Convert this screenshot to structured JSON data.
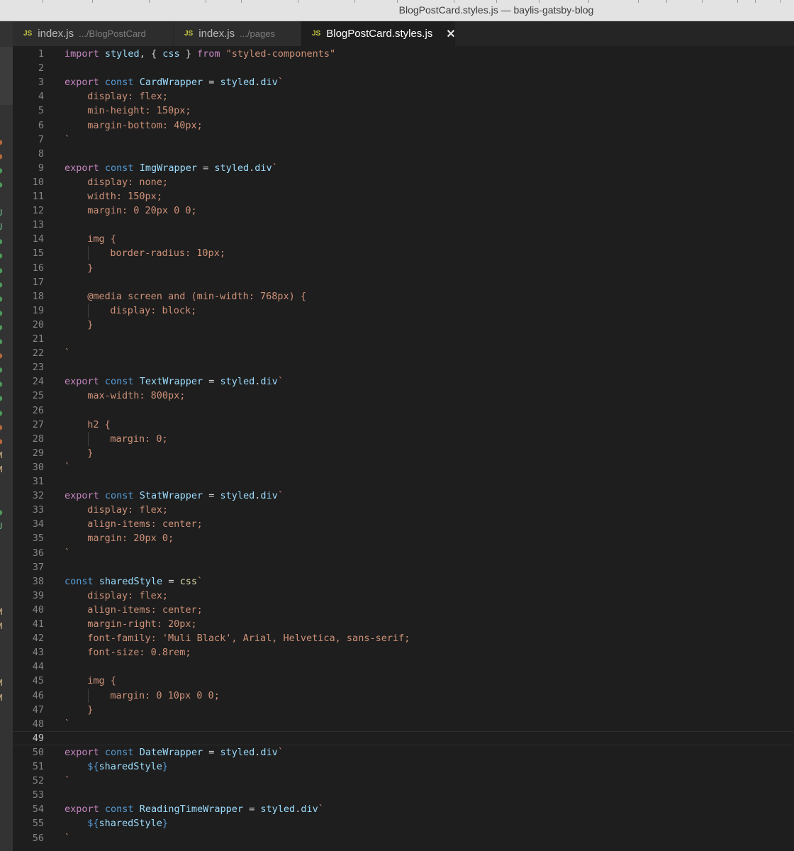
{
  "window": {
    "title": "BlogPostCard.styles.js — baylis-gatsby-blog"
  },
  "tabs": [
    {
      "icon": "JS",
      "name": "index.js",
      "description": ".../BlogPostCard",
      "active": false
    },
    {
      "icon": "JS",
      "name": "index.js",
      "description": ".../pages",
      "active": false
    },
    {
      "icon": "JS",
      "name": "BlogPostCard.styles.js",
      "description": "",
      "active": true,
      "close": "✕"
    }
  ],
  "editor": {
    "current_line": 49,
    "colors": {
      "keyword": "#c586c0",
      "storage": "#569cd6",
      "identifier": "#9cdcfe",
      "function": "#dcdcaa",
      "string": "#ce9178",
      "plain": "#d4d4d4"
    },
    "lines": [
      {
        "n": "1",
        "indent": 0,
        "tokens": [
          [
            "kw",
            "import"
          ],
          [
            "pl",
            " "
          ],
          [
            "id",
            "styled"
          ],
          [
            "pl",
            ", { "
          ],
          [
            "id",
            "css"
          ],
          [
            "pl",
            " } "
          ],
          [
            "kw",
            "from"
          ],
          [
            "pl",
            " "
          ],
          [
            "str",
            "\"styled-components\""
          ]
        ]
      },
      {
        "n": "2",
        "indent": 0,
        "tokens": []
      },
      {
        "n": "3",
        "indent": 0,
        "tokens": [
          [
            "kw",
            "export"
          ],
          [
            "pl",
            " "
          ],
          [
            "st",
            "const"
          ],
          [
            "pl",
            " "
          ],
          [
            "id",
            "CardWrapper"
          ],
          [
            "pl",
            " = "
          ],
          [
            "id",
            "styled"
          ],
          [
            "pl",
            "."
          ],
          [
            "id",
            "div"
          ],
          [
            "str",
            "`"
          ]
        ]
      },
      {
        "n": "4",
        "indent": 1,
        "tokens": [
          [
            "str",
            "display: flex;"
          ]
        ]
      },
      {
        "n": "5",
        "indent": 1,
        "tokens": [
          [
            "str",
            "min-height: 150px;"
          ]
        ]
      },
      {
        "n": "6",
        "indent": 1,
        "tokens": [
          [
            "str",
            "margin-bottom: 40px;"
          ]
        ]
      },
      {
        "n": "7",
        "indent": 0,
        "tokens": [
          [
            "str",
            "`"
          ]
        ]
      },
      {
        "n": "8",
        "indent": 0,
        "tokens": []
      },
      {
        "n": "9",
        "indent": 0,
        "tokens": [
          [
            "kw",
            "export"
          ],
          [
            "pl",
            " "
          ],
          [
            "st",
            "const"
          ],
          [
            "pl",
            " "
          ],
          [
            "id",
            "ImgWrapper"
          ],
          [
            "pl",
            " = "
          ],
          [
            "id",
            "styled"
          ],
          [
            "pl",
            "."
          ],
          [
            "id",
            "div"
          ],
          [
            "str",
            "`"
          ]
        ]
      },
      {
        "n": "10",
        "indent": 1,
        "tokens": [
          [
            "str",
            "display: none;"
          ]
        ]
      },
      {
        "n": "11",
        "indent": 1,
        "tokens": [
          [
            "str",
            "width: 150px;"
          ]
        ]
      },
      {
        "n": "12",
        "indent": 1,
        "tokens": [
          [
            "str",
            "margin: 0 20px 0 0;"
          ]
        ]
      },
      {
        "n": "13",
        "indent": 0,
        "tokens": []
      },
      {
        "n": "14",
        "indent": 1,
        "tokens": [
          [
            "str",
            "img {"
          ]
        ]
      },
      {
        "n": "15",
        "indent": 2,
        "tokens": [
          [
            "str",
            "border-radius: 10px;"
          ]
        ]
      },
      {
        "n": "16",
        "indent": 1,
        "tokens": [
          [
            "str",
            "}"
          ]
        ]
      },
      {
        "n": "17",
        "indent": 0,
        "tokens": []
      },
      {
        "n": "18",
        "indent": 1,
        "tokens": [
          [
            "str",
            "@media screen and (min-width: 768px) {"
          ]
        ]
      },
      {
        "n": "19",
        "indent": 2,
        "tokens": [
          [
            "str",
            "display: block;"
          ]
        ]
      },
      {
        "n": "20",
        "indent": 1,
        "tokens": [
          [
            "str",
            "}"
          ]
        ]
      },
      {
        "n": "21",
        "indent": 0,
        "tokens": []
      },
      {
        "n": "22",
        "indent": 0,
        "tokens": [
          [
            "str",
            "`"
          ]
        ]
      },
      {
        "n": "23",
        "indent": 0,
        "tokens": []
      },
      {
        "n": "24",
        "indent": 0,
        "tokens": [
          [
            "kw",
            "export"
          ],
          [
            "pl",
            " "
          ],
          [
            "st",
            "const"
          ],
          [
            "pl",
            " "
          ],
          [
            "id",
            "TextWrapper"
          ],
          [
            "pl",
            " = "
          ],
          [
            "id",
            "styled"
          ],
          [
            "pl",
            "."
          ],
          [
            "id",
            "div"
          ],
          [
            "str",
            "`"
          ]
        ]
      },
      {
        "n": "25",
        "indent": 1,
        "tokens": [
          [
            "str",
            "max-width: 800px;"
          ]
        ]
      },
      {
        "n": "26",
        "indent": 0,
        "tokens": []
      },
      {
        "n": "27",
        "indent": 1,
        "tokens": [
          [
            "str",
            "h2 {"
          ]
        ]
      },
      {
        "n": "28",
        "indent": 2,
        "tokens": [
          [
            "str",
            "margin: 0;"
          ]
        ]
      },
      {
        "n": "29",
        "indent": 1,
        "tokens": [
          [
            "str",
            "}"
          ]
        ]
      },
      {
        "n": "30",
        "indent": 0,
        "tokens": [
          [
            "str",
            "`"
          ]
        ]
      },
      {
        "n": "31",
        "indent": 0,
        "tokens": []
      },
      {
        "n": "32",
        "indent": 0,
        "tokens": [
          [
            "kw",
            "export"
          ],
          [
            "pl",
            " "
          ],
          [
            "st",
            "const"
          ],
          [
            "pl",
            " "
          ],
          [
            "id",
            "StatWrapper"
          ],
          [
            "pl",
            " = "
          ],
          [
            "id",
            "styled"
          ],
          [
            "pl",
            "."
          ],
          [
            "id",
            "div"
          ],
          [
            "str",
            "`"
          ]
        ]
      },
      {
        "n": "33",
        "indent": 1,
        "tokens": [
          [
            "str",
            "display: flex;"
          ]
        ]
      },
      {
        "n": "34",
        "indent": 1,
        "tokens": [
          [
            "str",
            "align-items: center;"
          ]
        ]
      },
      {
        "n": "35",
        "indent": 1,
        "tokens": [
          [
            "str",
            "margin: 20px 0;"
          ]
        ]
      },
      {
        "n": "36",
        "indent": 0,
        "tokens": [
          [
            "str",
            "`"
          ]
        ]
      },
      {
        "n": "37",
        "indent": 0,
        "tokens": []
      },
      {
        "n": "38",
        "indent": 0,
        "tokens": [
          [
            "st",
            "const"
          ],
          [
            "pl",
            " "
          ],
          [
            "id",
            "sharedStyle"
          ],
          [
            "pl",
            " = "
          ],
          [
            "fn",
            "css"
          ],
          [
            "str",
            "`"
          ]
        ]
      },
      {
        "n": "39",
        "indent": 1,
        "tokens": [
          [
            "str",
            "display: flex;"
          ]
        ]
      },
      {
        "n": "40",
        "indent": 1,
        "tokens": [
          [
            "str",
            "align-items: center;"
          ]
        ]
      },
      {
        "n": "41",
        "indent": 1,
        "tokens": [
          [
            "str",
            "margin-right: 20px;"
          ]
        ]
      },
      {
        "n": "42",
        "indent": 1,
        "tokens": [
          [
            "str",
            "font-family: 'Muli Black', Arial, Helvetica, sans-serif;"
          ]
        ]
      },
      {
        "n": "43",
        "indent": 1,
        "tokens": [
          [
            "str",
            "font-size: 0.8rem;"
          ]
        ]
      },
      {
        "n": "44",
        "indent": 0,
        "tokens": []
      },
      {
        "n": "45",
        "indent": 1,
        "tokens": [
          [
            "str",
            "img {"
          ]
        ]
      },
      {
        "n": "46",
        "indent": 2,
        "tokens": [
          [
            "str",
            "margin: 0 10px 0 0;"
          ]
        ]
      },
      {
        "n": "47",
        "indent": 1,
        "tokens": [
          [
            "str",
            "}"
          ]
        ]
      },
      {
        "n": "48",
        "indent": 0,
        "tokens": [
          [
            "str",
            "`"
          ]
        ]
      },
      {
        "n": "49",
        "indent": 0,
        "tokens": []
      },
      {
        "n": "50",
        "indent": 0,
        "tokens": [
          [
            "kw",
            "export"
          ],
          [
            "pl",
            " "
          ],
          [
            "st",
            "const"
          ],
          [
            "pl",
            " "
          ],
          [
            "id",
            "DateWrapper"
          ],
          [
            "pl",
            " = "
          ],
          [
            "id",
            "styled"
          ],
          [
            "pl",
            "."
          ],
          [
            "id",
            "div"
          ],
          [
            "str",
            "`"
          ]
        ]
      },
      {
        "n": "51",
        "indent": 1,
        "tokens": [
          [
            "st",
            "${"
          ],
          [
            "id",
            "sharedStyle"
          ],
          [
            "st",
            "}"
          ]
        ]
      },
      {
        "n": "52",
        "indent": 0,
        "tokens": [
          [
            "str",
            "`"
          ]
        ]
      },
      {
        "n": "53",
        "indent": 0,
        "tokens": []
      },
      {
        "n": "54",
        "indent": 0,
        "tokens": [
          [
            "kw",
            "export"
          ],
          [
            "pl",
            " "
          ],
          [
            "st",
            "const"
          ],
          [
            "pl",
            " "
          ],
          [
            "id",
            "ReadingTimeWrapper"
          ],
          [
            "pl",
            " = "
          ],
          [
            "id",
            "styled"
          ],
          [
            "pl",
            "."
          ],
          [
            "id",
            "div"
          ],
          [
            "str",
            "`"
          ]
        ]
      },
      {
        "n": "55",
        "indent": 1,
        "tokens": [
          [
            "st",
            "${"
          ],
          [
            "id",
            "sharedStyle"
          ],
          [
            "st",
            "}"
          ]
        ]
      },
      {
        "n": "56",
        "indent": 0,
        "tokens": [
          [
            "str",
            "`"
          ]
        ]
      }
    ]
  },
  "gutter_marks": [
    {
      "line": 7,
      "text": "●",
      "color": "#b5683a"
    },
    {
      "line": 8,
      "text": "●",
      "color": "#b5683a"
    },
    {
      "line": 9,
      "text": "●",
      "color": "#4d9a5a"
    },
    {
      "line": 10,
      "text": "●",
      "color": "#4d9a5a"
    },
    {
      "line": 12,
      "text": "U",
      "color": "#73c991"
    },
    {
      "line": 13,
      "text": "U",
      "color": "#73c991"
    },
    {
      "line": 14,
      "text": "●",
      "color": "#4d9a5a"
    },
    {
      "line": 15,
      "text": "●",
      "color": "#4d9a5a"
    },
    {
      "line": 16,
      "text": "●",
      "color": "#4d9a5a"
    },
    {
      "line": 17,
      "text": "●",
      "color": "#4d9a5a"
    },
    {
      "line": 18,
      "text": "●",
      "color": "#4d9a5a"
    },
    {
      "line": 19,
      "text": "●",
      "color": "#4d9a5a"
    },
    {
      "line": 20,
      "text": "●",
      "color": "#4d9a5a"
    },
    {
      "line": 21,
      "text": "●",
      "color": "#4d9a5a"
    },
    {
      "line": 22,
      "text": "●",
      "color": "#b5683a"
    },
    {
      "line": 23,
      "text": "●",
      "color": "#4d9a5a"
    },
    {
      "line": 24,
      "text": "●",
      "color": "#4d9a5a"
    },
    {
      "line": 25,
      "text": "●",
      "color": "#4d9a5a"
    },
    {
      "line": 26,
      "text": "●",
      "color": "#4d9a5a"
    },
    {
      "line": 27,
      "text": "●",
      "color": "#b5683a"
    },
    {
      "line": 28,
      "text": "●",
      "color": "#b5683a"
    },
    {
      "line": 29,
      "text": "M",
      "color": "#e2c08d"
    },
    {
      "line": 30,
      "text": "M",
      "color": "#e2c08d"
    },
    {
      "line": 33,
      "text": "●",
      "color": "#4d9a5a"
    },
    {
      "line": 34,
      "text": "U",
      "color": "#73c991"
    },
    {
      "line": 40,
      "text": "M",
      "color": "#e2c08d"
    },
    {
      "line": 41,
      "text": "M",
      "color": "#e2c08d"
    },
    {
      "line": 45,
      "text": "M",
      "color": "#e2c08d"
    },
    {
      "line": 46,
      "text": "M",
      "color": "#e2c08d"
    }
  ]
}
